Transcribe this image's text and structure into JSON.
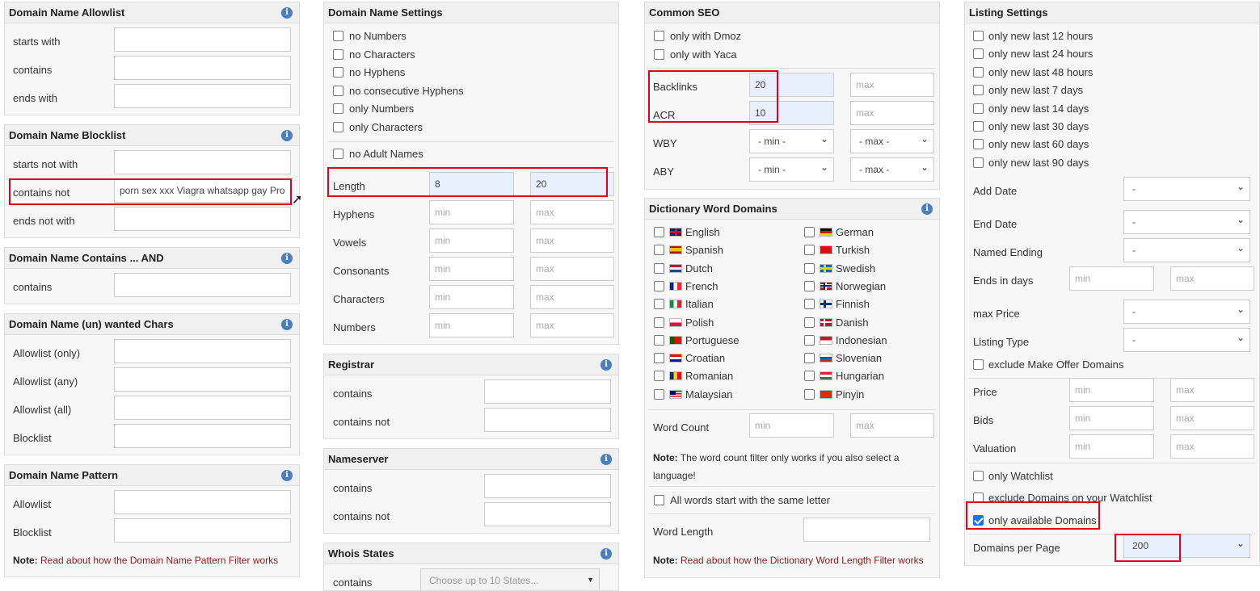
{
  "allowlist": {
    "title": "Domain Name Allowlist",
    "starts_with": "starts with",
    "contains": "contains",
    "ends_with": "ends with"
  },
  "blocklist": {
    "title": "Domain Name Blocklist",
    "starts_not_with": "starts not with",
    "contains_not": "contains not",
    "contains_not_value": "porn sex xxx Viagra whatsapp gay Pro",
    "ends_not_with": "ends not with"
  },
  "contains_and": {
    "title": "Domain Name Contains ... AND",
    "contains": "contains"
  },
  "wanted_chars": {
    "title": "Domain Name (un) wanted Chars",
    "allow_only": "Allowlist (only)",
    "allow_any": "Allowlist (any)",
    "allow_all": "Allowlist (all)",
    "blocklist": "Blocklist"
  },
  "pattern": {
    "title": "Domain Name Pattern",
    "allowlist": "Allowlist",
    "blocklist": "Blocklist",
    "note_label": "Note:",
    "note_text": "Read about how the Domain Name Pattern Filter works"
  },
  "settings": {
    "title": "Domain Name Settings",
    "checks": [
      "no Numbers",
      "no Characters",
      "no Hyphens",
      "no consecutive Hyphens",
      "only Numbers",
      "only Characters"
    ],
    "no_adult": "no Adult Names",
    "rows": [
      {
        "label": "Length",
        "min": "8",
        "max": "20"
      },
      {
        "label": "Hyphens",
        "min": "min",
        "max": "max"
      },
      {
        "label": "Vowels",
        "min": "min",
        "max": "max"
      },
      {
        "label": "Consonants",
        "min": "min",
        "max": "max"
      },
      {
        "label": "Characters",
        "min": "min",
        "max": "max"
      },
      {
        "label": "Numbers",
        "min": "min",
        "max": "max"
      }
    ]
  },
  "registrar": {
    "title": "Registrar",
    "contains": "contains",
    "contains_not": "contains not"
  },
  "nameserver": {
    "title": "Nameserver",
    "contains": "contains",
    "contains_not": "contains not"
  },
  "whois": {
    "title": "Whois States",
    "contains": "contains",
    "placeholder": "Choose up to 10 States..."
  },
  "seo": {
    "title": "Common SEO",
    "dmoz": "only with Dmoz",
    "yaca": "only with Yaca",
    "backlinks": "Backlinks",
    "backlinks_min": "20",
    "max": "max",
    "acr": "ACR",
    "acr_min": "10",
    "wby": "WBY",
    "aby": "ABY",
    "min_sel": "- min -",
    "max_sel": "- max -"
  },
  "dictionary": {
    "title": "Dictionary Word Domains",
    "left": [
      "English",
      "Spanish",
      "Dutch",
      "French",
      "Italian",
      "Polish",
      "Portuguese",
      "Croatian",
      "Romanian",
      "Malaysian"
    ],
    "right": [
      "German",
      "Turkish",
      "Swedish",
      "Norwegian",
      "Finnish",
      "Danish",
      "Indonesian",
      "Slovenian",
      "Hungarian",
      "Pinyin"
    ],
    "word_count": "Word Count",
    "min": "min",
    "max": "max",
    "note_label": "Note:",
    "note_text": "The word count filter only works if you also select a language!",
    "same_letter": "All words start with the same letter",
    "word_length": "Word Length",
    "note2_text": "Read about how the Dictionary Word Length Filter works"
  },
  "listing": {
    "title": "Listing Settings",
    "checks": [
      "only new last 12 hours",
      "only new last 24 hours",
      "only new last 48 hours",
      "only new last 7 days",
      "only new last 14 days",
      "only new last 30 days",
      "only new last 60 days",
      "only new last 90 days"
    ],
    "add_date": "Add Date",
    "end_date": "End Date",
    "named_ending": "Named Ending",
    "ends_in_days": "Ends in days",
    "max_price": "max Price",
    "listing_type": "Listing Type",
    "dash": "-",
    "min": "min",
    "max": "max",
    "exclude_offer": "exclude Make Offer Domains",
    "price": "Price",
    "bids": "Bids",
    "valuation": "Valuation",
    "only_watchlist": "only Watchlist",
    "exclude_watchlist": "exclude Domains on your Watchlist",
    "only_available": "only available Domains",
    "per_page": "Domains per Page",
    "per_page_value": "200"
  },
  "colors": {
    "highlight": "#e0001b",
    "accent": "#1a73e8"
  }
}
